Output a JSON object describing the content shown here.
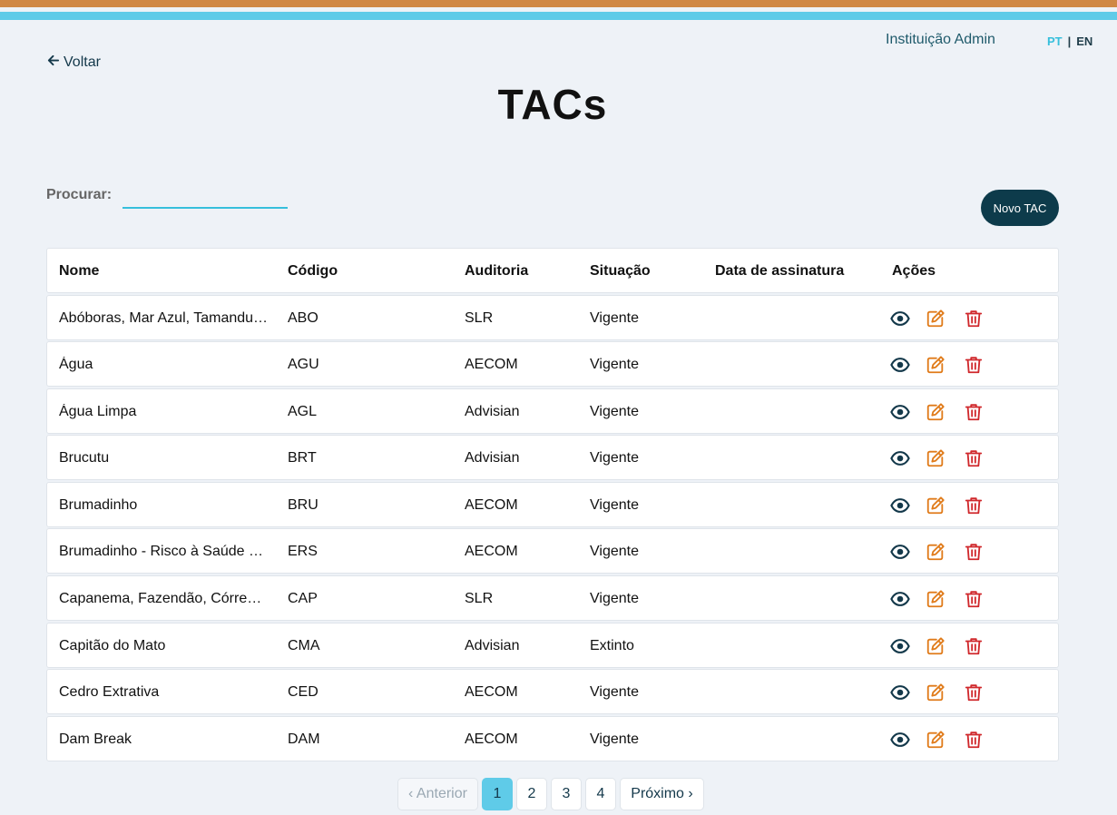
{
  "header": {
    "user_name": "Instituição Admin",
    "lang_pt": "PT",
    "lang_sep": "|",
    "lang_en": "EN",
    "back_label": "Voltar"
  },
  "page": {
    "title": "TACs"
  },
  "search": {
    "label": "Procurar:",
    "value": "",
    "placeholder": ""
  },
  "new_button": "Novo TAC",
  "table": {
    "columns": [
      "Nome",
      "Código",
      "Auditoria",
      "Situação",
      "Data de assinatura",
      "Ações"
    ],
    "rows": [
      {
        "nome": "Abóboras, Mar Azul, Tamanduá e Capão Xavier",
        "codigo": "ABO",
        "auditoria": "SLR",
        "situacao": "Vigente",
        "data": ""
      },
      {
        "nome": "Água",
        "codigo": "AGU",
        "auditoria": "AECOM",
        "situacao": "Vigente",
        "data": ""
      },
      {
        "nome": "Água Limpa",
        "codigo": "AGL",
        "auditoria": "Advisian",
        "situacao": "Vigente",
        "data": ""
      },
      {
        "nome": "Brucutu",
        "codigo": "BRT",
        "auditoria": "Advisian",
        "situacao": "Vigente",
        "data": ""
      },
      {
        "nome": "Brumadinho",
        "codigo": "BRU",
        "auditoria": "AECOM",
        "situacao": "Vigente",
        "data": ""
      },
      {
        "nome": "Brumadinho - Risco à Saúde Humana",
        "codigo": "ERS",
        "auditoria": "AECOM",
        "situacao": "Vigente",
        "data": ""
      },
      {
        "nome": "Capanema, Fazendão, Córrego do Feijão",
        "codigo": "CAP",
        "auditoria": "SLR",
        "situacao": "Vigente",
        "data": ""
      },
      {
        "nome": "Capitão do Mato",
        "codigo": "CMA",
        "auditoria": "Advisian",
        "situacao": "Extinto",
        "data": ""
      },
      {
        "nome": "Cedro Extrativa",
        "codigo": "CED",
        "auditoria": "AECOM",
        "situacao": "Vigente",
        "data": ""
      },
      {
        "nome": "Dam Break",
        "codigo": "DAM",
        "auditoria": "AECOM",
        "situacao": "Vigente",
        "data": ""
      }
    ]
  },
  "pagination": {
    "prev": "‹ Anterior",
    "pages": [
      "1",
      "2",
      "3",
      "4"
    ],
    "active": "1",
    "next": "Próximo ›"
  },
  "icons": {
    "view": "eye-icon",
    "edit": "pencil-square-icon",
    "delete": "trash-icon",
    "back": "arrow-left-icon"
  },
  "colors": {
    "top_stripe": "#d08845",
    "accent": "#5fcbe8",
    "primary_dark": "#0d3b4b",
    "edit_icon": "#e07b1a",
    "delete_icon": "#d0282c",
    "view_icon": "#13384a"
  }
}
